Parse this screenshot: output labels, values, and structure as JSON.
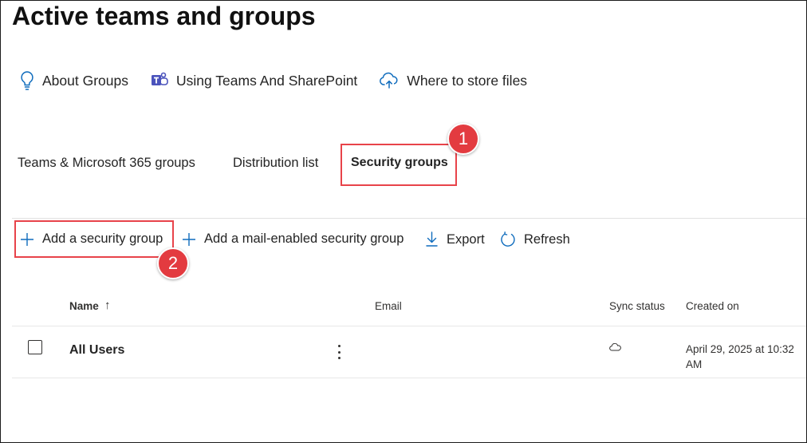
{
  "page": {
    "title": "Active teams and groups"
  },
  "links": [
    {
      "label": "About Groups",
      "icon": "lightbulb-icon"
    },
    {
      "label": "Using Teams And SharePoint",
      "icon": "teams-icon"
    },
    {
      "label": "Where to store files",
      "icon": "cloud-upload-icon"
    }
  ],
  "tabs": [
    {
      "label": "Teams & Microsoft 365 groups"
    },
    {
      "label": "Distribution list"
    },
    {
      "label": "Security groups",
      "active": true
    }
  ],
  "commands": {
    "add_security_group": "Add a security group",
    "add_mail_enabled": "Add a mail-enabled security group",
    "export": "Export",
    "refresh": "Refresh"
  },
  "table": {
    "columns": {
      "name": "Name",
      "sort_arrow": "↑",
      "email": "Email",
      "sync_status": "Sync status",
      "created_on": "Created on"
    },
    "rows": [
      {
        "name": "All Users",
        "email": "",
        "sync_status_icon": "cloud-icon",
        "created_on": "April 29, 2025 at 10:32 AM"
      }
    ]
  },
  "annotations": {
    "badge_1": "1",
    "badge_2": "2",
    "highlight_color": "#e8434a"
  },
  "colors": {
    "accent": "#0f6cbd",
    "badge": "#e33b40"
  }
}
